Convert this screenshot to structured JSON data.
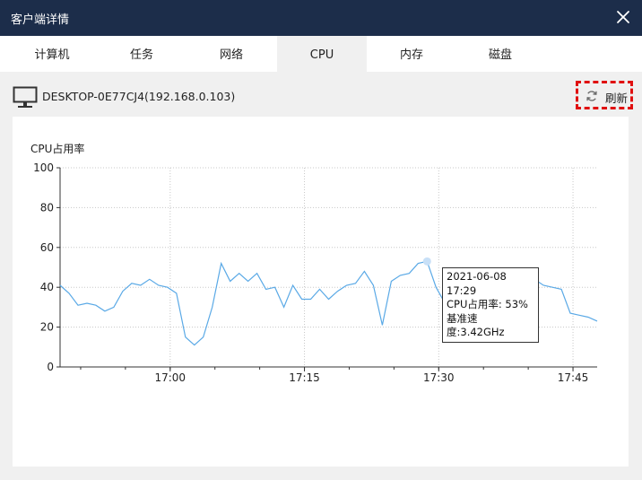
{
  "window": {
    "title": "客户端详情"
  },
  "tabs": [
    {
      "label": "计算机",
      "active": false
    },
    {
      "label": "任务",
      "active": false
    },
    {
      "label": "网络",
      "active": false
    },
    {
      "label": "CPU",
      "active": true
    },
    {
      "label": "内存",
      "active": false
    },
    {
      "label": "磁盘",
      "active": false
    }
  ],
  "device": {
    "name": "DESKTOP-0E77CJ4(192.168.0.103)"
  },
  "refresh": {
    "label": "刷新"
  },
  "tooltip": {
    "time": "2021-06-08 17:29",
    "usage": "CPU占用率: 53%",
    "speed": "基准速度:3.42GHz"
  },
  "colors": {
    "titlebar": "#1c2d4a",
    "line": "#5aa9e6",
    "highlight": "#e01010"
  },
  "chart_data": {
    "type": "line",
    "ylabel": "CPU占用率",
    "ylim": [
      0,
      100
    ],
    "yticks": [
      "0",
      "20",
      "40",
      "60",
      "80",
      "100"
    ],
    "xticks": [
      {
        "label": "17:00",
        "minute": 0
      },
      {
        "label": "17:15",
        "minute": 15
      },
      {
        "label": "17:30",
        "minute": 30
      },
      {
        "label": "17:45",
        "minute": 45
      }
    ],
    "x_minutes": [
      -12.3,
      -11.3,
      -10.3,
      -9.3,
      -8.3,
      -7.3,
      -6.3,
      -5.3,
      -4.3,
      -3.3,
      -2.3,
      -1.3,
      -0.3,
      0.7,
      1.7,
      2.7,
      3.7,
      4.7,
      5.7,
      6.7,
      7.7,
      8.7,
      9.7,
      10.7,
      11.7,
      12.7,
      13.7,
      14.7,
      15.7,
      16.7,
      17.7,
      18.7,
      19.7,
      20.7,
      21.7,
      22.7,
      23.7,
      24.7,
      25.7,
      26.7,
      27.7,
      28.7,
      29.7,
      30.7,
      31.7,
      32.7,
      33.7,
      34.7,
      35.7,
      36.7,
      37.7,
      38.7,
      39.7,
      40.7,
      41.7,
      42.7,
      43.7,
      44.7,
      45.7,
      46.7,
      47.7
    ],
    "y": [
      41,
      37,
      31,
      32,
      31,
      28,
      30,
      38,
      42,
      41,
      44,
      41,
      40,
      37,
      15,
      11,
      15,
      30,
      52,
      43,
      47,
      43,
      47,
      39,
      40,
      30,
      41,
      34,
      34,
      39,
      34,
      38,
      41,
      42,
      48,
      41,
      21,
      43,
      46,
      47,
      52,
      53,
      40,
      32,
      24,
      35,
      38,
      42,
      44,
      42,
      40,
      39,
      41,
      44,
      41,
      40,
      39,
      27,
      26,
      25,
      23
    ],
    "highlight_index": 41,
    "grid": true
  }
}
